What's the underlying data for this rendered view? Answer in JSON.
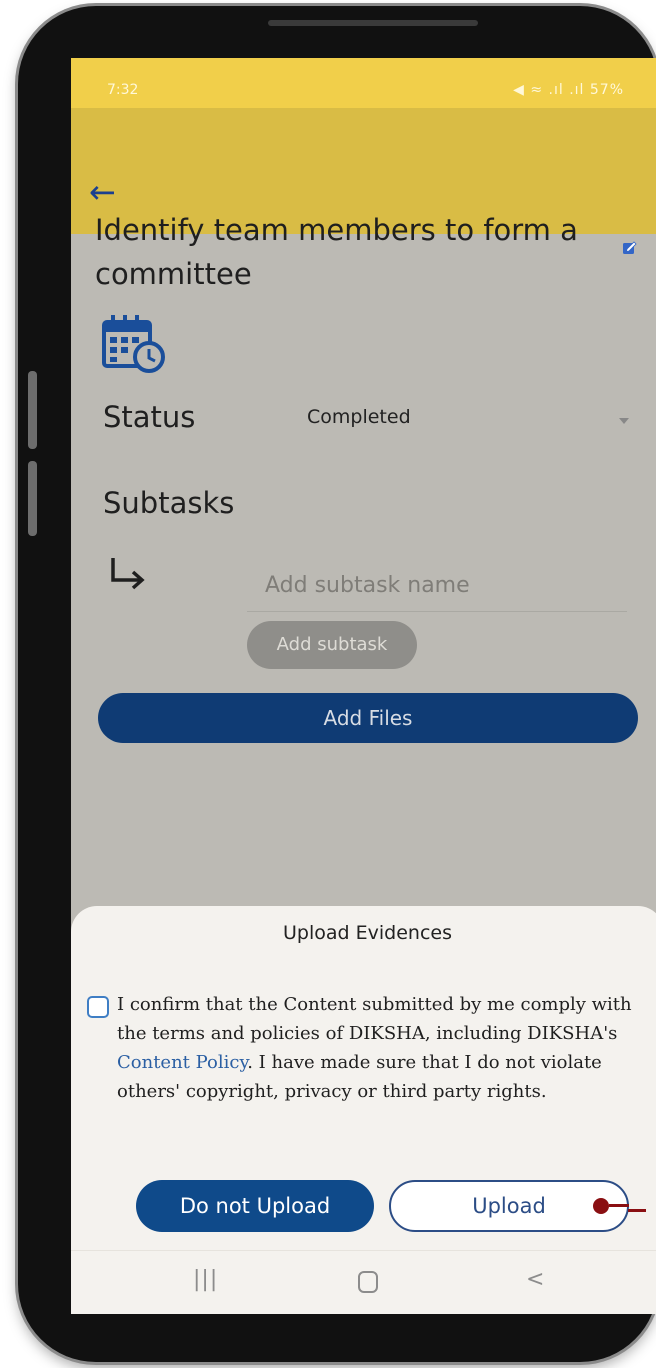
{
  "status_bar": {
    "time": "7:32",
    "indicators": "◀ ≈ .ıl .ıl 57%"
  },
  "app_bar": {
    "back_icon": "arrow-left-icon"
  },
  "task": {
    "title": "Identify team members to form a committee",
    "edit_icon": "edit-checkbox-icon",
    "calendar_icon": "calendar-clock-icon"
  },
  "status": {
    "label": "Status",
    "value": "Completed"
  },
  "subtasks": {
    "label": "Subtasks",
    "input_placeholder": "Add subtask name",
    "add_button_label": "Add subtask"
  },
  "add_files_label": "Add Files",
  "upload_sheet": {
    "title": "Upload Evidences",
    "consent_text_before": "I confirm that the Content submitted by me comply with the terms and policies of DIKSHA, including DIKSHA's ",
    "consent_link": "Content Policy",
    "consent_text_after": ". I have made sure that I do not violate others' copyright, privacy or third party rights.",
    "do_not_upload_label": "Do not Upload",
    "upload_label": "Upload"
  },
  "nav_bar": {
    "recent": "|||",
    "home_icon": "home-circle-icon",
    "back": "<"
  },
  "colors": {
    "app_bar": "#d9bc45",
    "status_bar": "#f1cf4a",
    "primary_button": "#0f3b74",
    "link": "#2b5fa3",
    "annotation": "#8a0f12"
  }
}
